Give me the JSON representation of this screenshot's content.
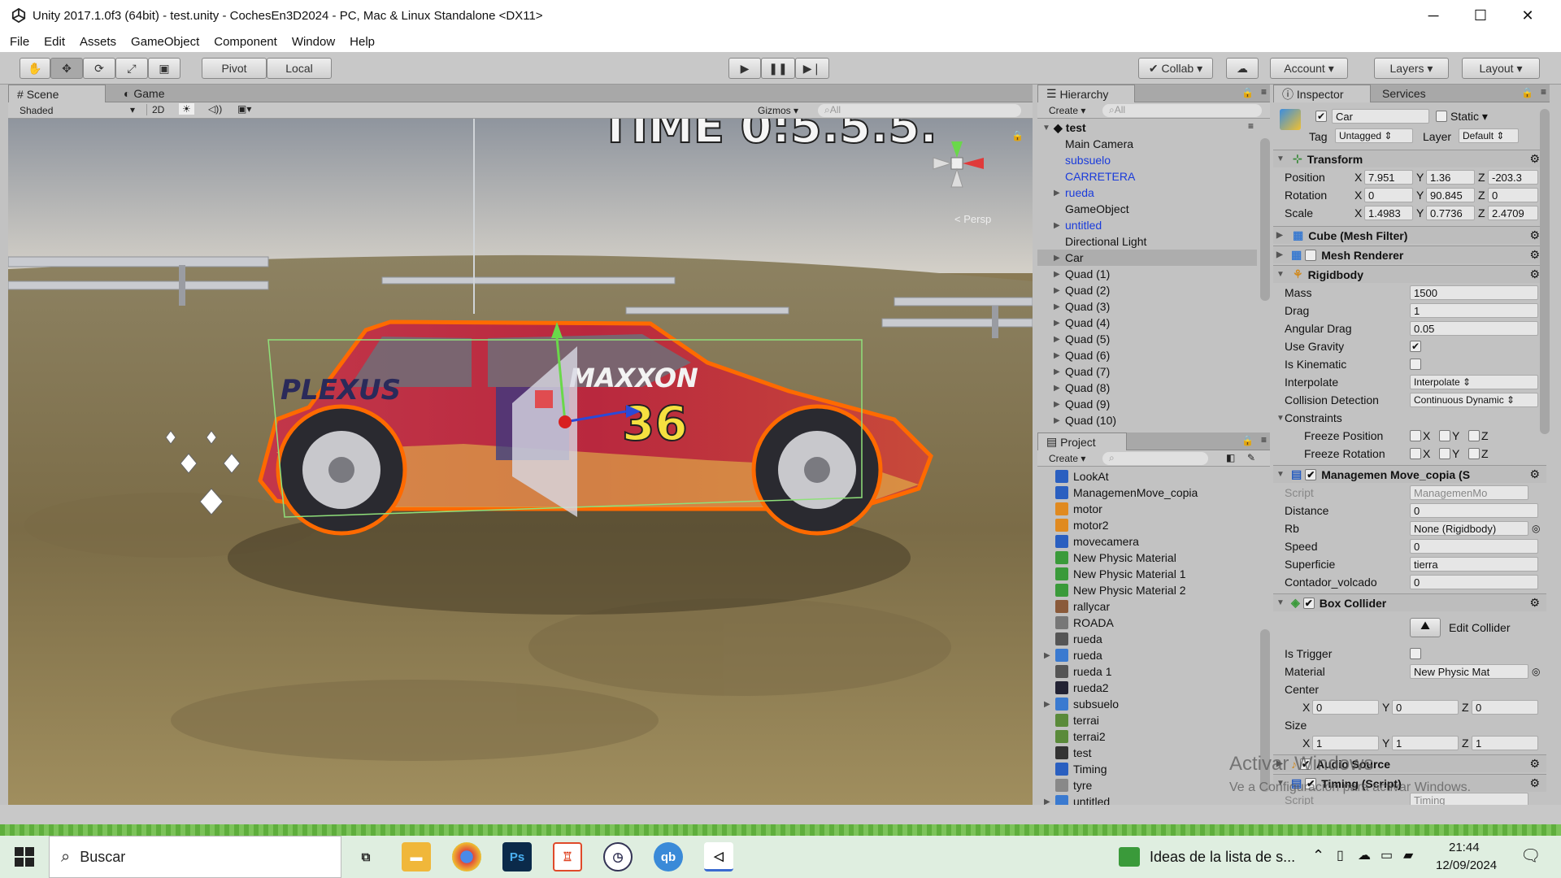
{
  "window": {
    "title": "Unity 2017.1.0f3 (64bit) - test.unity - CochesEn3D2024 - PC, Mac & Linux Standalone <DX11>",
    "minimize": "─",
    "maximize": "☐",
    "close": "✕"
  },
  "menu": [
    "File",
    "Edit",
    "Assets",
    "GameObject",
    "Component",
    "Window",
    "Help"
  ],
  "toolbar": {
    "pivot": "Pivot",
    "local": "Local",
    "collab": "✔ Collab ▾",
    "account": "Account",
    "layers": "Layers",
    "layout": "Layout"
  },
  "scene": {
    "tab_scene": "Scene",
    "tab_game": "Game",
    "shading": "Shaded",
    "mode2d": "2D",
    "gizmos": "Gizmos ▾",
    "search_placeholder": "All",
    "persp": "Persp",
    "hud_text": "TIME 0:5.5.5."
  },
  "hierarchy": {
    "tab": "Hierarchy",
    "create": "Create ▾",
    "search_placeholder": "All",
    "scene_name": "test",
    "items": [
      {
        "label": "Main Camera",
        "color": "#111",
        "arrow": false
      },
      {
        "label": "subsuelo",
        "color": "#1a3bdb",
        "arrow": false
      },
      {
        "label": "CARRETERA",
        "color": "#1a3bdb",
        "arrow": false
      },
      {
        "label": "rueda",
        "color": "#1a3bdb",
        "arrow": true
      },
      {
        "label": "GameObject",
        "color": "#111",
        "arrow": false
      },
      {
        "label": "untitled",
        "color": "#1a3bdb",
        "arrow": true
      },
      {
        "label": "Directional Light",
        "color": "#111",
        "arrow": false
      },
      {
        "label": "Car",
        "color": "#111",
        "arrow": true,
        "selected": true
      },
      {
        "label": "Quad (1)",
        "color": "#111",
        "arrow": true
      },
      {
        "label": "Quad (2)",
        "color": "#111",
        "arrow": true
      },
      {
        "label": "Quad (3)",
        "color": "#111",
        "arrow": true
      },
      {
        "label": "Quad (4)",
        "color": "#111",
        "arrow": true
      },
      {
        "label": "Quad (5)",
        "color": "#111",
        "arrow": true
      },
      {
        "label": "Quad (6)",
        "color": "#111",
        "arrow": true
      },
      {
        "label": "Quad (7)",
        "color": "#111",
        "arrow": true
      },
      {
        "label": "Quad (8)",
        "color": "#111",
        "arrow": true
      },
      {
        "label": "Quad (9)",
        "color": "#111",
        "arrow": true
      },
      {
        "label": "Quad (10)",
        "color": "#111",
        "arrow": true
      }
    ]
  },
  "project": {
    "tab": "Project",
    "create": "Create ▾",
    "items": [
      {
        "label": "LookAt",
        "icon": "script-icon",
        "color": "#2a5fc0"
      },
      {
        "label": "ManagemenMove_copia",
        "icon": "script-icon",
        "color": "#2a5fc0"
      },
      {
        "label": "motor",
        "icon": "audio-icon",
        "color": "#e08a20"
      },
      {
        "label": "motor2",
        "icon": "audio-icon",
        "color": "#e08a20"
      },
      {
        "label": "movecamera",
        "icon": "script-icon",
        "color": "#2a5fc0"
      },
      {
        "label": "New Physic Material",
        "icon": "physic-material-icon",
        "color": "#3a9a3a"
      },
      {
        "label": "New Physic Material 1",
        "icon": "physic-material-icon",
        "color": "#3a9a3a"
      },
      {
        "label": "New Physic Material 2",
        "icon": "physic-material-icon",
        "color": "#3a9a3a"
      },
      {
        "label": "rallycar",
        "icon": "texture-icon",
        "color": "#8a5a3a"
      },
      {
        "label": "ROADA",
        "icon": "texture-icon",
        "color": "#777"
      },
      {
        "label": "rueda",
        "icon": "material-icon",
        "color": "#555"
      },
      {
        "label": "rueda",
        "icon": "prefab-icon",
        "color": "#3a7ad0"
      },
      {
        "label": "rueda 1",
        "icon": "material-icon",
        "color": "#555"
      },
      {
        "label": "rueda2",
        "icon": "texture-icon",
        "color": "#223"
      },
      {
        "label": "subsuelo",
        "icon": "prefab-icon",
        "color": "#3a7ad0"
      },
      {
        "label": "terrai",
        "icon": "texture-icon",
        "color": "#5a8a3a"
      },
      {
        "label": "terrai2",
        "icon": "texture-icon",
        "color": "#5a8a3a"
      },
      {
        "label": "test",
        "icon": "scene-icon",
        "color": "#333"
      },
      {
        "label": "Timing",
        "icon": "script-icon",
        "color": "#2a5fc0"
      },
      {
        "label": "tyre",
        "icon": "texture-icon",
        "color": "#888"
      },
      {
        "label": "untitled",
        "icon": "prefab-icon",
        "color": "#3a7ad0"
      }
    ]
  },
  "inspector": {
    "tab": "Inspector",
    "services_tab": "Services",
    "name": "Car",
    "static": "Static ▾",
    "tag_label": "Tag",
    "tag": "Untagged",
    "layer_label": "Layer",
    "layer": "Default",
    "transform": {
      "title": "Transform",
      "position_label": "Position",
      "rotation_label": "Rotation",
      "scale_label": "Scale",
      "position": [
        "7.951",
        "1.36",
        "-203.3"
      ],
      "rotation": [
        "0",
        "90.845",
        "0"
      ],
      "scale": [
        "1.4983",
        "0.7736",
        "2.4709"
      ]
    },
    "mesh_filter": "Cube (Mesh Filter)",
    "mesh_renderer": "Mesh Renderer",
    "rigidbody": {
      "title": "Rigidbody",
      "mass_label": "Mass",
      "mass": "1500",
      "drag_label": "Drag",
      "drag": "1",
      "angular_label": "Angular Drag",
      "angular": "0.05",
      "gravity_label": "Use Gravity",
      "kinematic_label": "Is Kinematic",
      "interpolate_label": "Interpolate",
      "interpolate": "Interpolate",
      "collision_label": "Collision Detection",
      "collision": "Continuous Dynamic",
      "constraints_label": "Constraints",
      "freeze_pos_label": "Freeze Position",
      "freeze_rot_label": "Freeze Rotation"
    },
    "script_comp": {
      "title": "Managemen Move_copia (S",
      "script_label": "Script",
      "script": "ManagemenMo",
      "distance_label": "Distance",
      "distance": "0",
      "rb_label": "Rb",
      "rb": "None (Rigidbody)",
      "speed_label": "Speed",
      "speed": "0",
      "superficie_label": "Superficie",
      "superficie": "tierra",
      "contador_label": "Contador_volcado",
      "contador": "0"
    },
    "box_collider": {
      "title": "Box Collider",
      "edit": "Edit Collider",
      "trigger_label": "Is Trigger",
      "material_label": "Material",
      "material": "New Physic Mat",
      "center_label": "Center",
      "center": [
        "0",
        "0",
        "0"
      ],
      "size_label": "Size",
      "size": [
        "1",
        "1",
        "1"
      ]
    },
    "audio_source": "Audio Source",
    "timing": "Timing (Script)",
    "timing_script_label": "Script",
    "timing_script": "Timing"
  },
  "watermark": {
    "line1": "Activar Windows",
    "line2": "Ve a Configuración para activar Windows."
  },
  "taskbar": {
    "search": "Buscar",
    "news": "Ideas de la lista de s...",
    "time": "21:44",
    "date": "12/09/2024"
  }
}
